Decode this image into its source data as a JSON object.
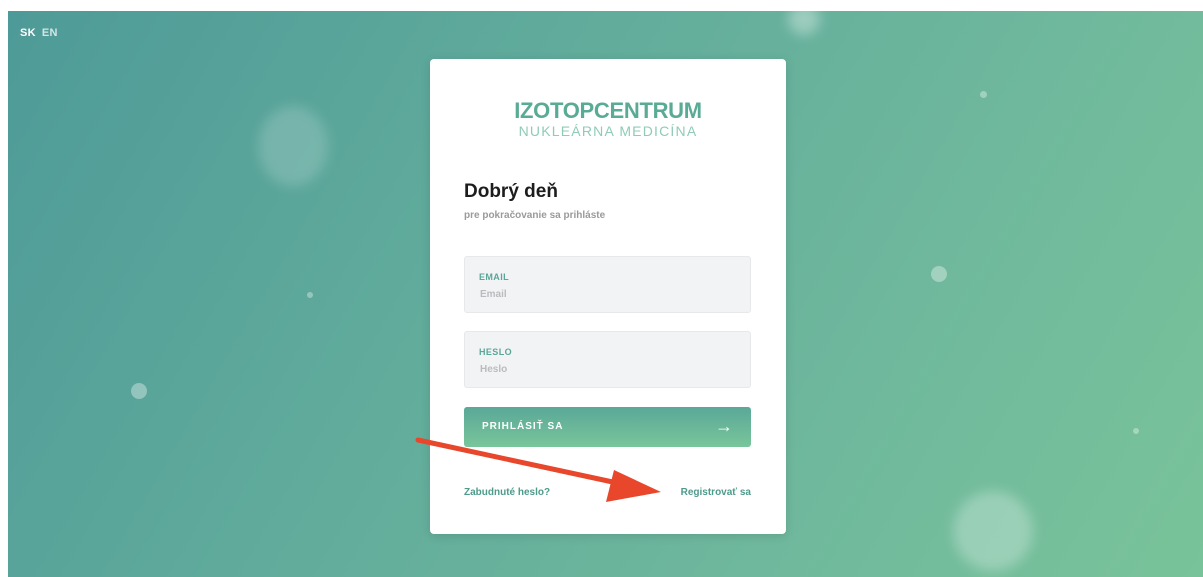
{
  "language_switcher": {
    "sk": "SK",
    "en": "EN"
  },
  "logo": {
    "main": "IZOTOPCENTRUM",
    "sub": "NUKLEÁRNA MEDICÍNA"
  },
  "greeting": {
    "title": "Dobrý deň",
    "subtitle": "pre pokračovanie sa prihláste"
  },
  "email_field": {
    "label": "EMAIL",
    "placeholder": "Email",
    "value": ""
  },
  "password_field": {
    "label": "HESLO",
    "placeholder": "Heslo",
    "value": ""
  },
  "login_button": {
    "label": "PRIHLÁSIŤ SA",
    "icon": "arrow-right-icon"
  },
  "links": {
    "forgot_password": "Zabudnuté heslo?",
    "register": "Registrovať sa"
  },
  "colors": {
    "brand": "#5aab95",
    "annotation_arrow": "#e8472c"
  }
}
